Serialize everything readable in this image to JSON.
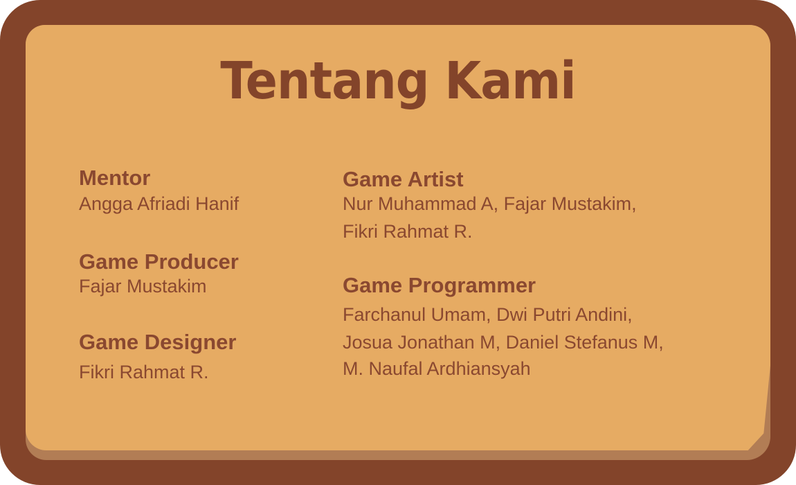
{
  "title": "Tentang Kami",
  "left_column": [
    {
      "role": "Mentor",
      "names": "Angga Afriadi Hanif"
    },
    {
      "role": "Game Producer",
      "names": "Fajar Mustakim"
    },
    {
      "role": "Game Designer",
      "names": "Fikri Rahmat R."
    }
  ],
  "right_column": [
    {
      "role": "Game Artist",
      "names": [
        "Nur Muhammad A, Fajar Mustakim,",
        "Fikri Rahmat R."
      ]
    },
    {
      "role": "Game Programmer",
      "names": [
        "Farchanul Umam, Dwi Putri Andini,",
        "Josua Jonathan M, Daniel Stefanus M,",
        "M. Naufal Ardhiansyah"
      ]
    }
  ],
  "colors": {
    "frame": "#83442a",
    "paper": "#e6ab63",
    "paper_shadow": "#b27d55",
    "text": "#8a4830"
  }
}
